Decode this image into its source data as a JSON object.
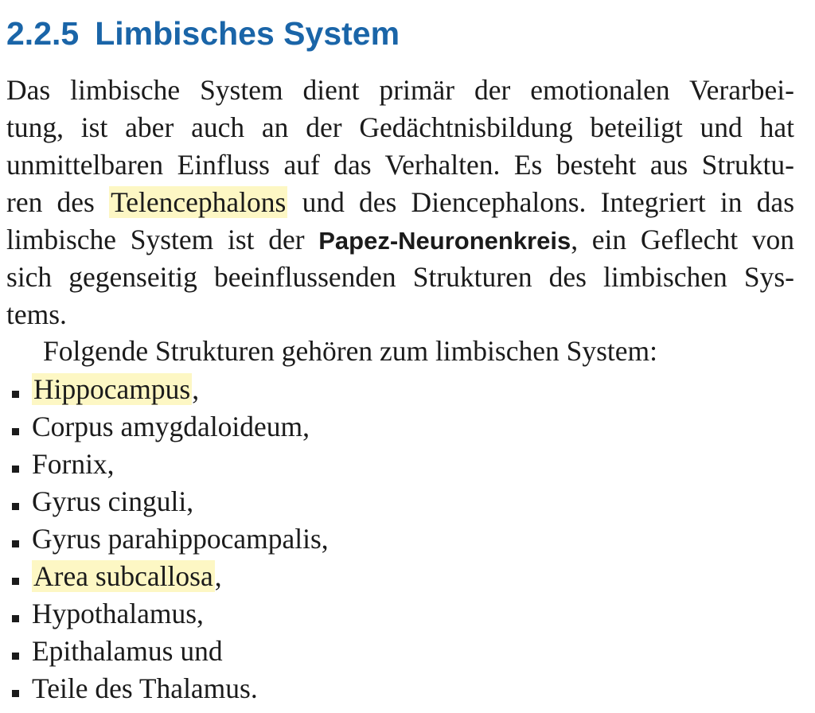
{
  "section": {
    "number": "2.2.5",
    "title": "Limbisches System"
  },
  "paragraph": {
    "line1": "Das limbische System dient primär der emotionalen Verarbei-",
    "line2": "tung, ist aber auch an der Gedächtnisbildung beteiligt und hat",
    "line3": "unmittelbaren Einfluss auf das Verhalten. Es besteht aus Struktu-",
    "line4_pre": "ren des ",
    "line4_highlight": "Telencephalons",
    "line4_post": " und des Diencephalons. Integriert in das",
    "line5_pre": "limbische System ist der ",
    "line5_bold": "Papez-Neuronenkreis",
    "line5_post": ", ein Geflecht von",
    "line6": "sich gegenseitig beeinflussenden Strukturen des limbischen Sys-",
    "line7": "tems."
  },
  "intro": "Folgende Strukturen gehören zum limbischen System:",
  "list": [
    {
      "text": "Hippocampus",
      "suffix": ",",
      "highlight": true
    },
    {
      "text": "Corpus amygdaloideum,",
      "suffix": "",
      "highlight": false
    },
    {
      "text": "Fornix,",
      "suffix": "",
      "highlight": false
    },
    {
      "text": "Gyrus cinguli,",
      "suffix": "",
      "highlight": false
    },
    {
      "text": "Gyrus parahippocampalis,",
      "suffix": "",
      "highlight": false
    },
    {
      "text": "Area subcallosa",
      "suffix": ",",
      "highlight": true
    },
    {
      "text": "Hypothalamus,",
      "suffix": "",
      "highlight": false
    },
    {
      "text": "Epithalamus und",
      "suffix": "",
      "highlight": false
    },
    {
      "text": "Teile des Thalamus.",
      "suffix": "",
      "highlight": false
    }
  ],
  "colors": {
    "heading": "#1a65a8",
    "highlight": "#fdf7c4",
    "text": "#1b1b1b"
  }
}
